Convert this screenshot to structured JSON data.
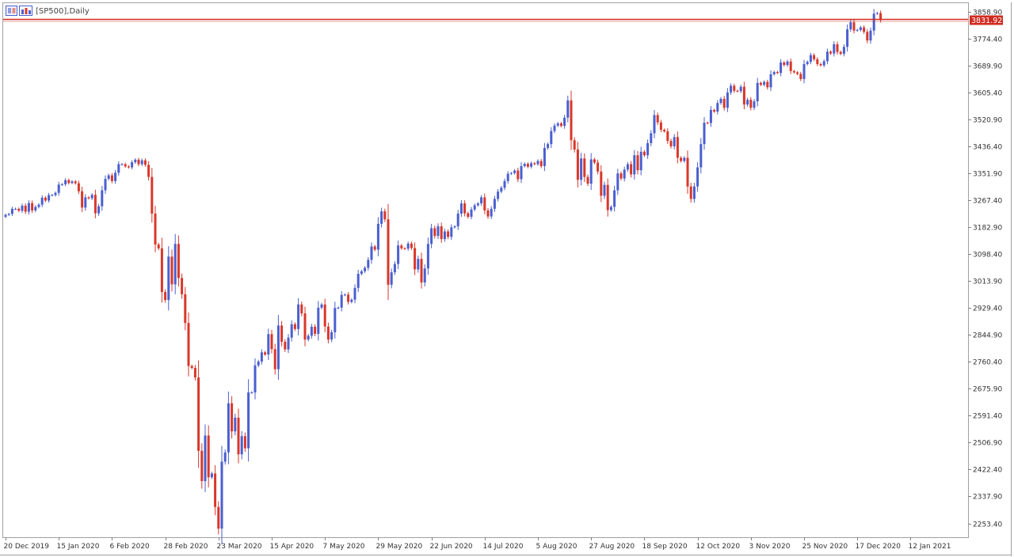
{
  "window": {
    "title": "[SP500],Daily",
    "icons": [
      "chart-window-icon",
      "bar-chart-icon"
    ]
  },
  "colors": {
    "bull": "#4a5fcf",
    "bear": "#d9372a",
    "price_line": "#d02b20",
    "background": "#ffffff",
    "frame": "#a0a0a0"
  },
  "current_price": {
    "label": "3831.92",
    "value": 3831.92
  },
  "chart_data": {
    "type": "candlestick",
    "title": "[SP500],Daily",
    "ylim": [
      2210,
      3885
    ],
    "y_ticks": [
      {
        "label": "3858.90",
        "value": 3858.9
      },
      {
        "label": "3774.40",
        "value": 3774.4
      },
      {
        "label": "3689.90",
        "value": 3689.9
      },
      {
        "label": "3605.40",
        "value": 3605.4
      },
      {
        "label": "3520.90",
        "value": 3520.9
      },
      {
        "label": "3436.40",
        "value": 3436.4
      },
      {
        "label": "3351.90",
        "value": 3351.9
      },
      {
        "label": "3267.40",
        "value": 3267.4
      },
      {
        "label": "3182.90",
        "value": 3182.9
      },
      {
        "label": "3098.40",
        "value": 3098.4
      },
      {
        "label": "3013.90",
        "value": 3013.9
      },
      {
        "label": "2929.40",
        "value": 2929.4
      },
      {
        "label": "2844.90",
        "value": 2844.9
      },
      {
        "label": "2760.40",
        "value": 2760.4
      },
      {
        "label": "2675.90",
        "value": 2675.9
      },
      {
        "label": "2591.40",
        "value": 2591.4
      },
      {
        "label": "2506.90",
        "value": 2506.9
      },
      {
        "label": "2422.40",
        "value": 2422.4
      },
      {
        "label": "2337.90",
        "value": 2337.9
      },
      {
        "label": "2253.40",
        "value": 2253.4
      }
    ],
    "x_ticks": [
      {
        "label": "20 Dec 2019",
        "index": 0
      },
      {
        "label": "15 Jan 2020",
        "index": 16
      },
      {
        "label": "6 Feb 2020",
        "index": 32
      },
      {
        "label": "28 Feb 2020",
        "index": 48
      },
      {
        "label": "23 Mar 2020",
        "index": 64
      },
      {
        "label": "15 Apr 2020",
        "index": 80
      },
      {
        "label": "7 May 2020",
        "index": 96
      },
      {
        "label": "29 May 2020",
        "index": 112
      },
      {
        "label": "22 Jun 2020",
        "index": 128
      },
      {
        "label": "14 Jul 2020",
        "index": 144
      },
      {
        "label": "5 Aug 2020",
        "index": 160
      },
      {
        "label": "27 Aug 2020",
        "index": 176
      },
      {
        "label": "18 Sep 2020",
        "index": 192
      },
      {
        "label": "12 Oct 2020",
        "index": 208
      },
      {
        "label": "3 Nov 2020",
        "index": 224
      },
      {
        "label": "25 Nov 2020",
        "index": 240
      },
      {
        "label": "17 Dec 2020",
        "index": 256
      },
      {
        "label": "12 Jan 2021",
        "index": 272
      }
    ],
    "closes": [
      3221,
      3224,
      3240,
      3240,
      3234,
      3250,
      3231,
      3258,
      3235,
      3246,
      3253,
      3275,
      3266,
      3283,
      3283,
      3290,
      3316,
      3317,
      3330,
      3321,
      3326,
      3320,
      3295,
      3244,
      3276,
      3273,
      3284,
      3226,
      3248,
      3298,
      3334,
      3345,
      3327,
      3353,
      3380,
      3380,
      3373,
      3370,
      3386,
      3394,
      3380,
      3392,
      3378,
      3340,
      3225,
      3128,
      3116,
      2979,
      2954,
      3090,
      3003,
      3130,
      3023,
      2972,
      2882,
      2747,
      2741,
      2711,
      2481,
      2386,
      2529,
      2398,
      2410,
      2305,
      2237,
      2447,
      2476,
      2630,
      2542,
      2585,
      2470,
      2527,
      2489,
      2664,
      2664,
      2749,
      2761,
      2790,
      2783,
      2847,
      2800,
      2737,
      2874,
      2823,
      2799,
      2836,
      2878,
      2863,
      2940,
      2912,
      2830,
      2842,
      2870,
      2848,
      2930,
      2940,
      2871,
      2830,
      2853,
      2929,
      2930,
      2970,
      2971,
      2948,
      2955,
      2992,
      3036,
      3044,
      3055,
      3080,
      3122,
      3112,
      3193,
      3232,
      3207,
      3002,
      3041,
      3067,
      3125,
      3116,
      3115,
      3131,
      3117,
      3050,
      3083,
      3009,
      3053,
      3130,
      3179,
      3155,
      3185,
      3145,
      3169,
      3152,
      3182,
      3185,
      3225,
      3257,
      3226,
      3215,
      3238,
      3251,
      3257,
      3276,
      3235,
      3216,
      3240,
      3271,
      3294,
      3306,
      3327,
      3350,
      3352,
      3360,
      3333,
      3374,
      3381,
      3372,
      3383,
      3380,
      3390,
      3374,
      3431,
      3443,
      3484,
      3501,
      3508,
      3500,
      3526,
      3580,
      3455,
      3426,
      3331,
      3398,
      3340,
      3319,
      3395,
      3385,
      3357,
      3281,
      3315,
      3236,
      3246,
      3298,
      3351,
      3335,
      3363,
      3380,
      3348,
      3408,
      3361,
      3419,
      3408,
      3446,
      3477,
      3534,
      3511,
      3488,
      3483,
      3453,
      3436,
      3465,
      3400,
      3390,
      3400,
      3310,
      3271,
      3310,
      3370,
      3443,
      3510,
      3509,
      3550,
      3545,
      3572,
      3585,
      3557,
      3605,
      3626,
      3610,
      3609,
      3623,
      3567,
      3582,
      3557,
      3577,
      3635,
      3629,
      3638,
      3621,
      3662,
      3669,
      3666,
      3699,
      3691,
      3702,
      3672,
      3668,
      3663,
      3647,
      3694,
      3701,
      3722,
      3709,
      3694,
      3690,
      3703,
      3733,
      3727,
      3756,
      3732,
      3726,
      3748,
      3803,
      3825,
      3799,
      3801,
      3809,
      3795,
      3768,
      3799,
      3852,
      3854,
      3832
    ]
  }
}
